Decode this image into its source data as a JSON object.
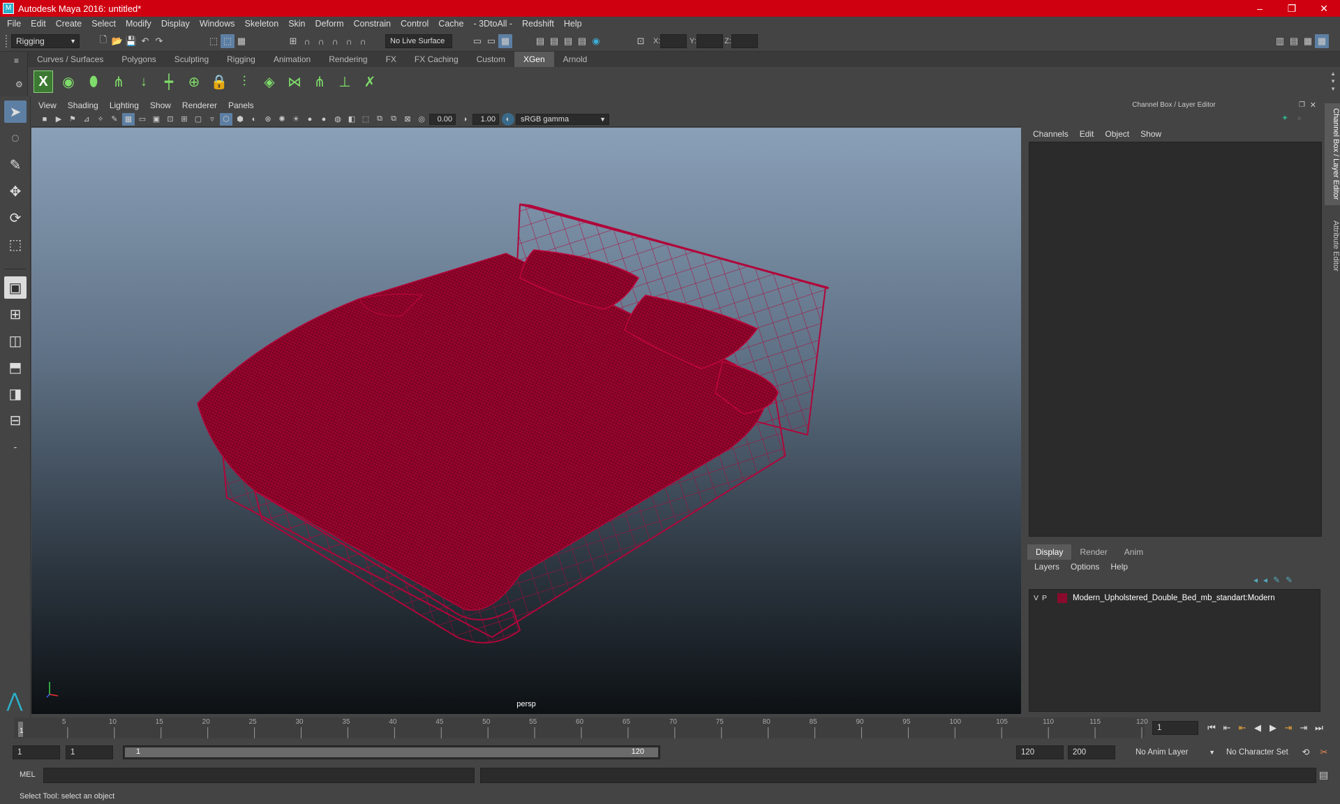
{
  "window": {
    "title": "Autodesk Maya 2016: untitled*",
    "app_icon": "M",
    "controls": [
      "–",
      "❐",
      "✕"
    ]
  },
  "menubar": [
    "File",
    "Edit",
    "Create",
    "Select",
    "Modify",
    "Display",
    "Windows",
    "Skeleton",
    "Skin",
    "Deform",
    "Constrain",
    "Control",
    "Cache",
    "- 3DtoAll -",
    "Redshift",
    "Help"
  ],
  "statusline": {
    "menuset": "Rigging",
    "live_surface": "No Live Surface",
    "coord_x_label": "X:",
    "coord_y_label": "Y:",
    "coord_z_label": "Z:"
  },
  "shelf": {
    "tabs": [
      "Curves / Surfaces",
      "Polygons",
      "Sculpting",
      "Rigging",
      "Animation",
      "Rendering",
      "FX",
      "FX Caching",
      "Custom",
      "XGen",
      "Arnold"
    ],
    "active_tab": "XGen"
  },
  "panel": {
    "menu": [
      "View",
      "Shading",
      "Lighting",
      "Show",
      "Renderer",
      "Panels"
    ],
    "exposure": "0.00",
    "gamma": "1.00",
    "colorspace": "sRGB gamma",
    "camera_label": "persp"
  },
  "channelbox": {
    "header": "Channel Box / Layer Editor",
    "menu": [
      "Channels",
      "Edit",
      "Object",
      "Show"
    ]
  },
  "layer_editor": {
    "tabs": [
      "Display",
      "Render",
      "Anim"
    ],
    "active_tab": "Display",
    "menu": [
      "Layers",
      "Options",
      "Help"
    ],
    "layers": [
      {
        "v": "V",
        "p": "P",
        "name": "Modern_Upholstered_Double_Bed_mb_standart:Modern",
        "color": "#8a0a2e"
      }
    ]
  },
  "side_tabs": [
    "Channel Box / Layer Editor",
    "Attribute Editor"
  ],
  "timeslider": {
    "ticks": [
      "5",
      "10",
      "15",
      "20",
      "25",
      "30",
      "35",
      "40",
      "45",
      "50",
      "55",
      "60",
      "65",
      "70",
      "75",
      "80",
      "85",
      "90",
      "95",
      "100",
      "105",
      "110",
      "115",
      "120"
    ],
    "start_label": "1",
    "current_frame": "1"
  },
  "range": {
    "start": "1",
    "start2": "1",
    "slider_start": "1",
    "slider_end": "120",
    "end": "120",
    "max_end": "200",
    "anim_layer": "No Anim Layer",
    "char_set": "No Character Set"
  },
  "cmdline": {
    "lang": "MEL"
  },
  "helpline": "Select Tool: select an object",
  "colors": {
    "wireframe": "#b0063a",
    "titlebar": "#cf0010",
    "active_tool": "#5d7fa3"
  }
}
